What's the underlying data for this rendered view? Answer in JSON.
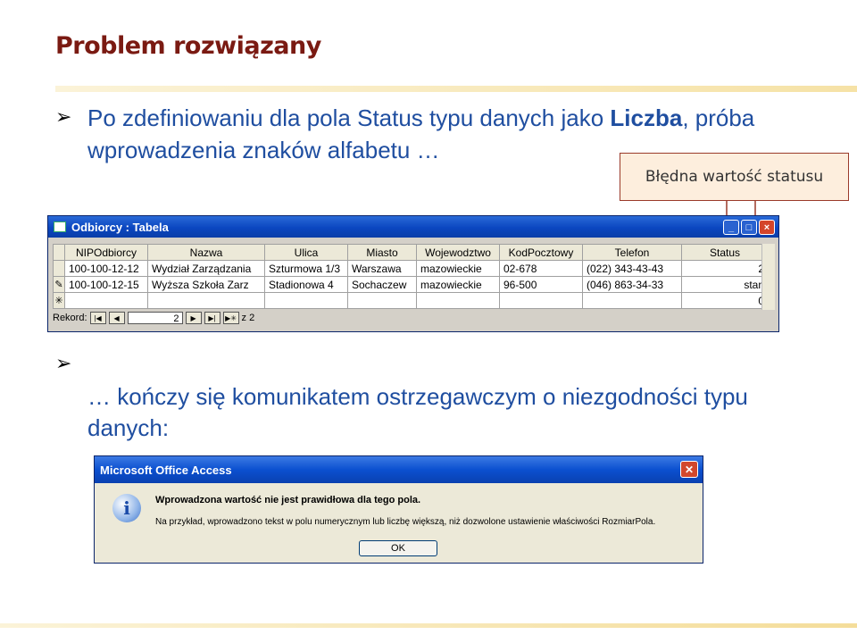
{
  "slide": {
    "title": "Problem rozwiązany",
    "bullet1_text": "Po zdefiniowaniu dla pola Status typu danych jako ",
    "bullet1_bold": "Liczba",
    "bullet1_end": ", próba wprowadzenia znaków alfabetu …",
    "bullet2_text": "… kończy się komunikatem ostrzegawczym o niezgodności typu danych:",
    "callout_text": "Błędna wartość statusu",
    "arrow_color": "#9a3a2a",
    "title_color": "#7a1a12",
    "text_color": "#1f4ea0"
  },
  "table_window": {
    "title": "Odbiorcy : Tabela",
    "columns": [
      "NIPOdbiorcy",
      "Nazwa",
      "Ulica",
      "Miasto",
      "Wojewodztwo",
      "KodPocztowy",
      "Telefon",
      "Status"
    ],
    "rows": [
      {
        "selector": "",
        "cells": [
          "100-100-12-12",
          "Wydział Zarządzania",
          "Szturmowa 1/3",
          "Warszawa",
          "mazowieckie",
          "02-678",
          "(022) 343-43-43",
          "2"
        ]
      },
      {
        "selector": "✎",
        "cells": [
          "100-100-12-15",
          "Wyższa Szkoła Zarz",
          "Stadionowa 4",
          "Sochaczew",
          "mazowieckie",
          "96-500",
          "(046) 863-34-33",
          "stan"
        ]
      },
      {
        "selector": "✳",
        "cells": [
          "",
          "",
          "",
          "",
          "",
          "",
          "",
          "0"
        ]
      }
    ],
    "nav": {
      "label": "Rekord:",
      "current": "2",
      "total_label": "z 2"
    }
  },
  "message_box": {
    "title": "Microsoft Office Access",
    "heading": "Wprowadzona wartość nie jest prawidłowa dla tego pola.",
    "body": "Na przykład, wprowadzono tekst w polu numerycznym lub liczbę większą, niż dozwolone ustawienie właściwości RozmiarPola.",
    "ok_label": "OK"
  }
}
